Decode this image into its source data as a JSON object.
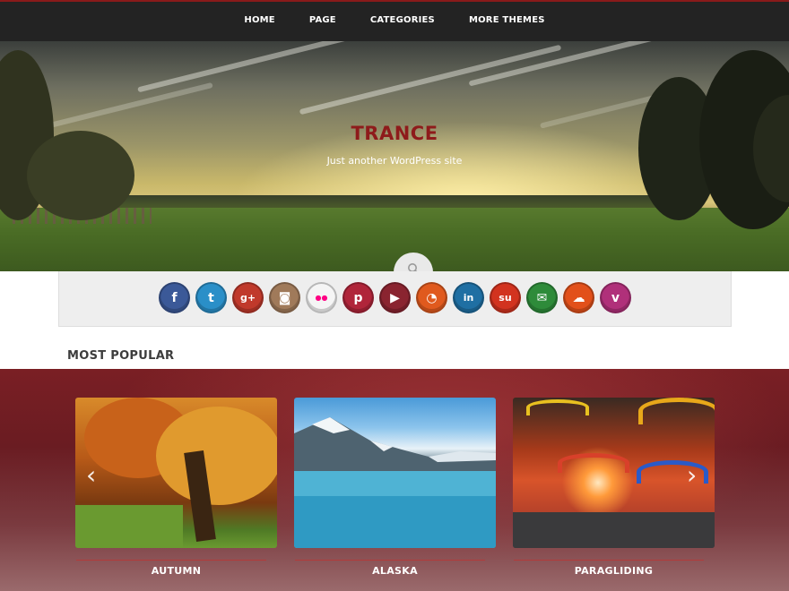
{
  "nav": {
    "items": [
      {
        "label": "HOME"
      },
      {
        "label": "PAGE"
      },
      {
        "label": "CATEGORIES"
      },
      {
        "label": "MORE THEMES"
      }
    ]
  },
  "header": {
    "title": "TRANCE",
    "tagline": "Just another WordPress site",
    "search_icon": "search-icon"
  },
  "social": {
    "icons": [
      {
        "name": "facebook-icon",
        "glyph": "f",
        "color": "#3b5998"
      },
      {
        "name": "twitter-icon",
        "glyph": "t",
        "color": "#2a8fc8"
      },
      {
        "name": "google-plus-icon",
        "glyph": "g+",
        "color": "#c0392b"
      },
      {
        "name": "instagram-icon",
        "glyph": "◙",
        "color": "#a07a5a"
      },
      {
        "name": "flickr-icon",
        "glyph": "●●",
        "color": "#f5f5f5"
      },
      {
        "name": "pinterest-icon",
        "glyph": "p",
        "color": "#b0253a"
      },
      {
        "name": "youtube-icon",
        "glyph": "▶",
        "color": "#8a2430"
      },
      {
        "name": "rss-icon",
        "glyph": "◔",
        "color": "#e05a1e"
      },
      {
        "name": "linkedin-icon",
        "glyph": "in",
        "color": "#1f6fa3"
      },
      {
        "name": "stumbleupon-icon",
        "glyph": "su",
        "color": "#d2331f"
      },
      {
        "name": "email-icon",
        "glyph": "✉",
        "color": "#2e8b3a"
      },
      {
        "name": "soundcloud-icon",
        "glyph": "☁",
        "color": "#e2501a"
      },
      {
        "name": "vimeo-icon",
        "glyph": "v",
        "color": "#b0307a"
      }
    ]
  },
  "popular": {
    "heading": "MOST POPULAR",
    "cards": [
      {
        "title": "AUTUMN"
      },
      {
        "title": "ALASKA"
      },
      {
        "title": "PARAGLIDING"
      }
    ],
    "prev_icon": "chevron-left-icon",
    "next_icon": "chevron-right-icon"
  }
}
